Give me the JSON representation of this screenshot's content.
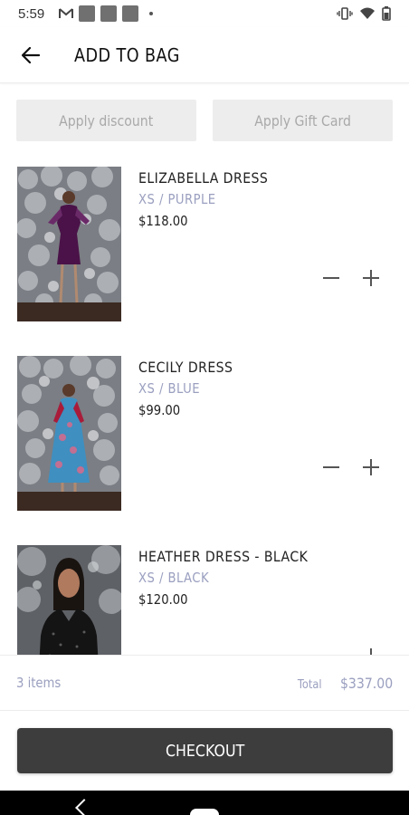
{
  "status_bar": {
    "time": "5:59"
  },
  "header": {
    "title": "ADD TO BAG"
  },
  "promo": {
    "discount_label": "Apply discount",
    "gift_card_label": "Apply Gift Card"
  },
  "items": [
    {
      "name": "ELIZABELLA DRESS",
      "variant": "XS / PURPLE",
      "price": "$118.00",
      "dress_color": "#4a1248"
    },
    {
      "name": "CECILY DRESS",
      "variant": "XS / BLUE",
      "price": "$99.00",
      "dress_color": "#3f8fc0"
    },
    {
      "name": "HEATHER DRESS - BLACK",
      "variant": "XS / BLACK",
      "price": "$120.00",
      "dress_color": "#141414"
    }
  ],
  "summary": {
    "count": "3 items",
    "total_label": "Total",
    "total_value": "$337.00"
  },
  "checkout": {
    "label": "CHECKOUT"
  },
  "colors": {
    "accent_muted": "#9a9fbf",
    "button_dark": "#3d3d3d",
    "promo_bg": "#ededed"
  }
}
